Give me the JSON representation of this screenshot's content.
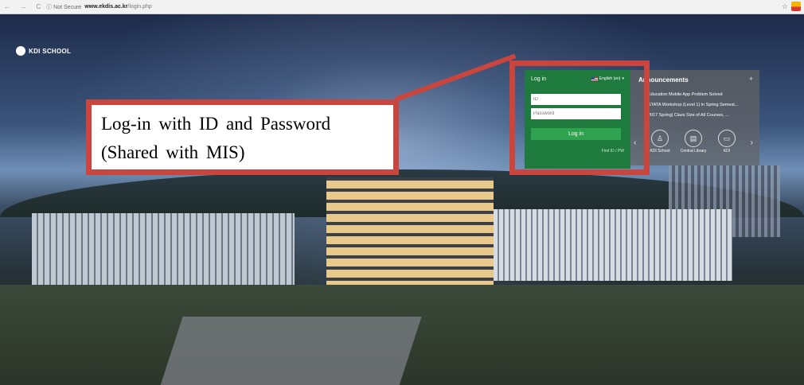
{
  "browser": {
    "nav_icons": "← → C",
    "secure_label": "ⓘ Not Secure",
    "url_host": "www.ekdis.ac.kr",
    "url_path": "/login.php"
  },
  "site": {
    "logo_text": "KDI SCHOOL"
  },
  "login": {
    "title": "Log in",
    "language": "English (en)",
    "id_placeholder": "ID",
    "password_placeholder": "Password",
    "button_label": "Log in",
    "find_link": "Find ID / PW"
  },
  "announcements": {
    "title": "Announcements",
    "items": [
      "Education Mobile App Problem Solved",
      "STATA Workshop (Level 1) in Spring Semest...",
      "2017 Spring] Class Size of All Courses, ..."
    ],
    "quick_links": [
      {
        "label": "KDI School",
        "icon": "kdi-school-icon"
      },
      {
        "label": "Central Library",
        "icon": "library-icon"
      },
      {
        "label": "KDI",
        "icon": "monitor-icon"
      }
    ]
  },
  "callout": {
    "line1": "Log-in with ID and Password",
    "line2": "(Shared with MIS)"
  },
  "colors": {
    "highlight": "#c9453d",
    "login_green": "#1f7a3d",
    "button_green": "#2fa24f"
  }
}
